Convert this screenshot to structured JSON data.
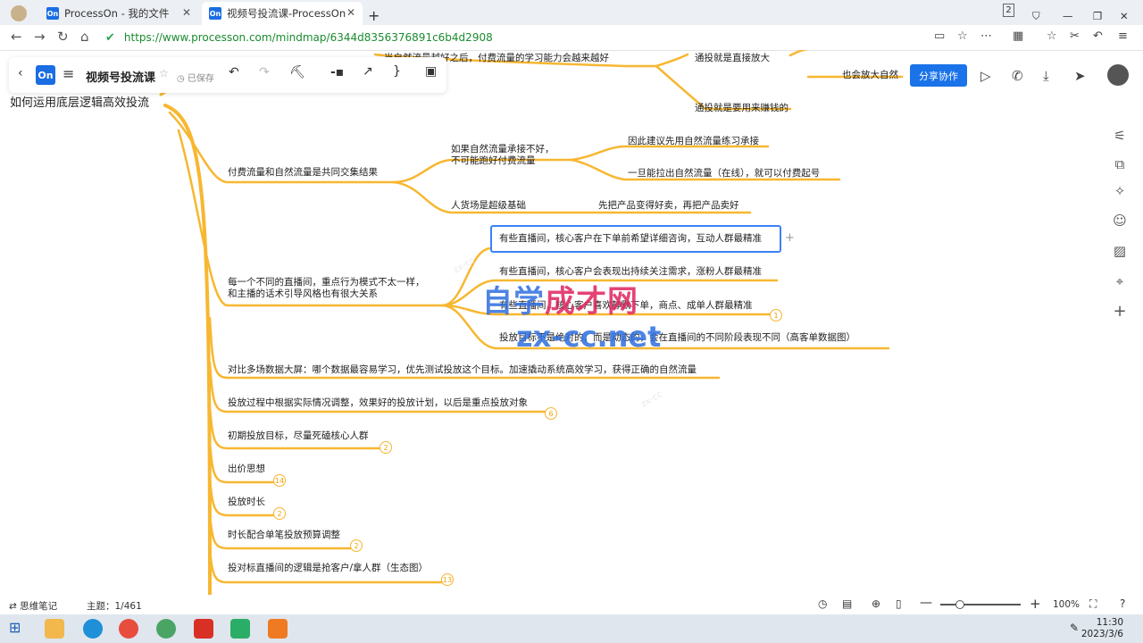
{
  "browser": {
    "tabs": [
      {
        "label": "ProcessOn - 我的文件"
      },
      {
        "label": "视频号投流课-ProcessOn"
      }
    ],
    "url": "https://www.processon.com/mindmap/6344d8356376891c6b4d2908",
    "tab_count_badge": "2"
  },
  "toolbar": {
    "logo": "On",
    "title": "视频号投流课",
    "saved_status": "已保存",
    "share_label": "分享协作"
  },
  "mindmap": {
    "root": "如何运用底层逻辑高效投流",
    "top_fragments": {
      "t1": "当自然流量越好之后，付费流量的学习能力会越来越好",
      "t2": "通投就是直接放大",
      "t3": "也会放大自然",
      "t4": "通投就是要用来赚钱的"
    },
    "branches": [
      {
        "label": "付费流量和自然流量是共同交集结果"
      },
      {
        "label": "每一个不同的直播间，重点行为模式不太一样，\n和主播的话术引导风格也有很大关系"
      },
      {
        "label": "对比多场数据大屏：哪个数据最容易学习，优先测试投放这个目标。加速撬动系统高效学习，获得正确的自然流量"
      },
      {
        "label": "投放过程中根据实际情况调整，效果好的投放计划，以后是重点投放对象",
        "badge": "6"
      },
      {
        "label": "初期投放目标，尽量死磕核心人群",
        "badge": "2"
      },
      {
        "label": "出价思想",
        "badge": "14"
      },
      {
        "label": "投放时长",
        "badge": "2"
      },
      {
        "label": "时长配合单笔投放预算调整",
        "badge": "2"
      },
      {
        "label": "投对标直播间的逻辑是抢客户/拿人群（生态图）",
        "badge": "13"
      }
    ],
    "sub_traffic": {
      "a": "如果自然流量承接不好，\n不可能跑好付费流量",
      "a1": "因此建议先用自然流量练习承接",
      "a2": "一旦能拉出自然流量（在线），就可以付费起号",
      "b": "人货场是超级基础",
      "b1": "先把产品变得好卖，再把产品卖好"
    },
    "sub_rooms": [
      {
        "label": "有些直播间，核心客户在下单前希望详细咨询，互动人群最精准"
      },
      {
        "label": "有些直播间，核心客户会表现出持续关注需求，涨粉人群最精准"
      },
      {
        "label": "有些直播间，核心客户喜欢静默下单，商点、成单人群最精准",
        "badge": "1"
      },
      {
        "label": "投放目标不是绝对的，而是动态的，会在直播间的不同阶段表现不同（高客单数据图）"
      }
    ]
  },
  "watermark": {
    "line1": "自学成才网",
    "line2": "zx-cc.net"
  },
  "statusbar": {
    "notes_label": "思维笔记",
    "topic_count": "主题：1/461",
    "zoom": "100%"
  },
  "clock": {
    "time": "11:30",
    "date": "2023/3/6"
  },
  "colors": {
    "branch": "#f7b731",
    "accent": "#1a73e8",
    "selected": "#3b82f6"
  }
}
